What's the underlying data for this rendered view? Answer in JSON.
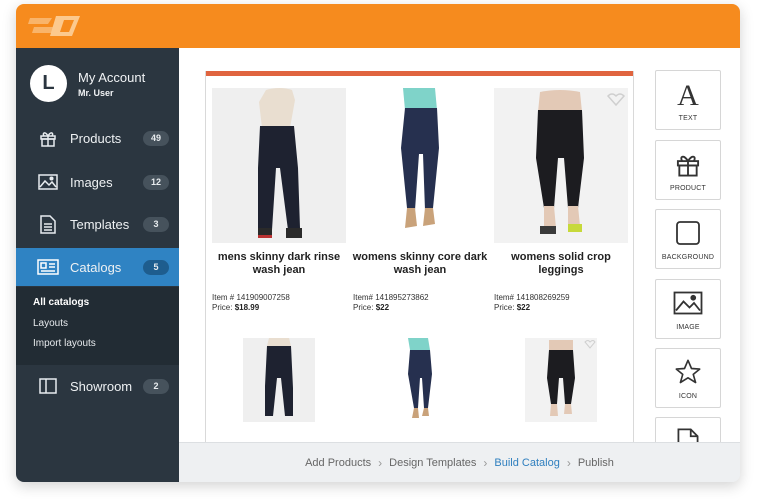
{
  "account": {
    "initial": "L",
    "name": "My Account",
    "user": "Mr. User"
  },
  "nav": {
    "products": {
      "label": "Products",
      "count": "49"
    },
    "images": {
      "label": "Images",
      "count": "12"
    },
    "templates": {
      "label": "Templates",
      "count": "3"
    },
    "catalogs": {
      "label": "Catalogs",
      "count": "5"
    },
    "showroom": {
      "label": "Showroom",
      "count": "2"
    }
  },
  "subnav": {
    "all": "All catalogs",
    "layouts": "Layouts",
    "import": "Import layouts"
  },
  "products": [
    {
      "title": "mens skinny dark rinse wash jean",
      "item": "Item # 141909007258",
      "price_label": "Price:",
      "price": "$18.99"
    },
    {
      "title": "womens skinny core dark wash jean",
      "item": "Item# 141895273862",
      "price_label": "Price:",
      "price": "$22"
    },
    {
      "title": "womens solid crop leggings",
      "item": "Item# 141808269259",
      "price_label": "Price:",
      "price": "$22"
    }
  ],
  "tools": {
    "text": "TEXT",
    "product": "PRODUCT",
    "background": "BACKGROUND",
    "image": "IMAGE",
    "icon": "ICON"
  },
  "steps": {
    "add_products": "Add Products",
    "design_templates": "Design Templates",
    "build_catalog": "Build Catalog",
    "publish": "Publish"
  },
  "colors": {
    "topbar": "#f68b1e",
    "sidebar": "#2b3640",
    "active": "#2f83c3",
    "accent_bar": "#e0643f"
  }
}
